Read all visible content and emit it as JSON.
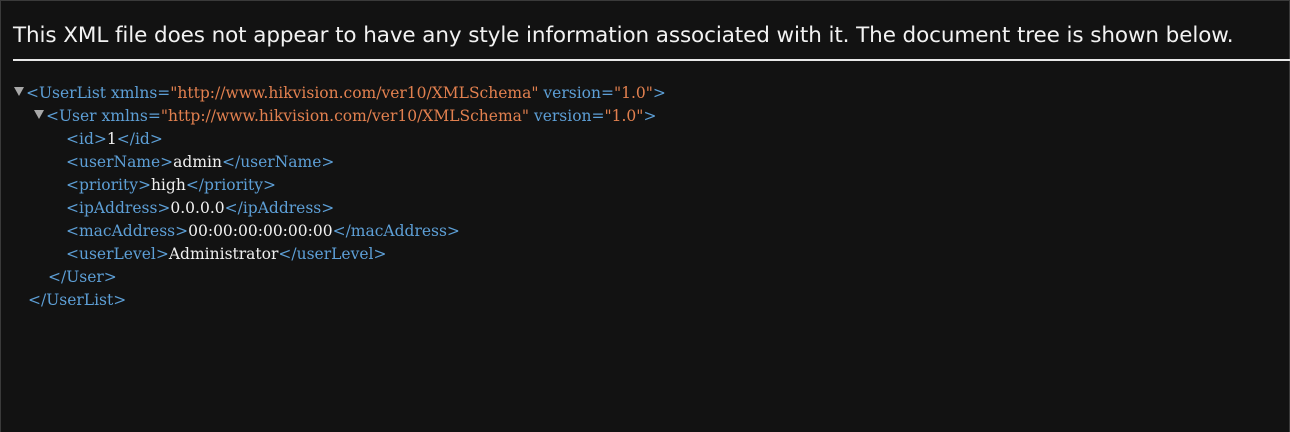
{
  "header": {
    "message": "This XML file does not appear to have any style information associated with it. The document tree is shown below."
  },
  "tree": {
    "root_open": "<UserList",
    "root_attr1_name": " xmlns=",
    "root_attr1_value": "\"http://www.hikvision.com/ver10/XMLSchema\"",
    "root_attr2_name": " version=",
    "root_attr2_value": "\"1.0\"",
    "root_open_end": ">",
    "user_open": "<User",
    "user_attr1_name": " xmlns=",
    "user_attr1_value": "\"http://www.hikvision.com/ver10/XMLSchema\"",
    "user_attr2_name": " version=",
    "user_attr2_value": "\"1.0\"",
    "user_open_end": ">",
    "fields": [
      {
        "open": "<id>",
        "value": "1",
        "close": "</id>"
      },
      {
        "open": "<userName>",
        "value": "admin",
        "close": "</userName>"
      },
      {
        "open": "<priority>",
        "value": "high",
        "close": "</priority>"
      },
      {
        "open": "<ipAddress>",
        "value": "0.0.0.0",
        "close": "</ipAddress>"
      },
      {
        "open": "<macAddress>",
        "value": "00:00:00:00:00:00",
        "close": "</macAddress>"
      },
      {
        "open": "<userLevel>",
        "value": "Administrator",
        "close": "</userLevel>"
      }
    ],
    "user_close": "</User>",
    "root_close": "</UserList>"
  },
  "colors": {
    "background": "#121212",
    "tag": "#5d9fd6",
    "attribute_value": "#e2804f",
    "text": "#f0f0f0"
  },
  "icons": {
    "expand_toggle": "triangle-down-icon"
  }
}
